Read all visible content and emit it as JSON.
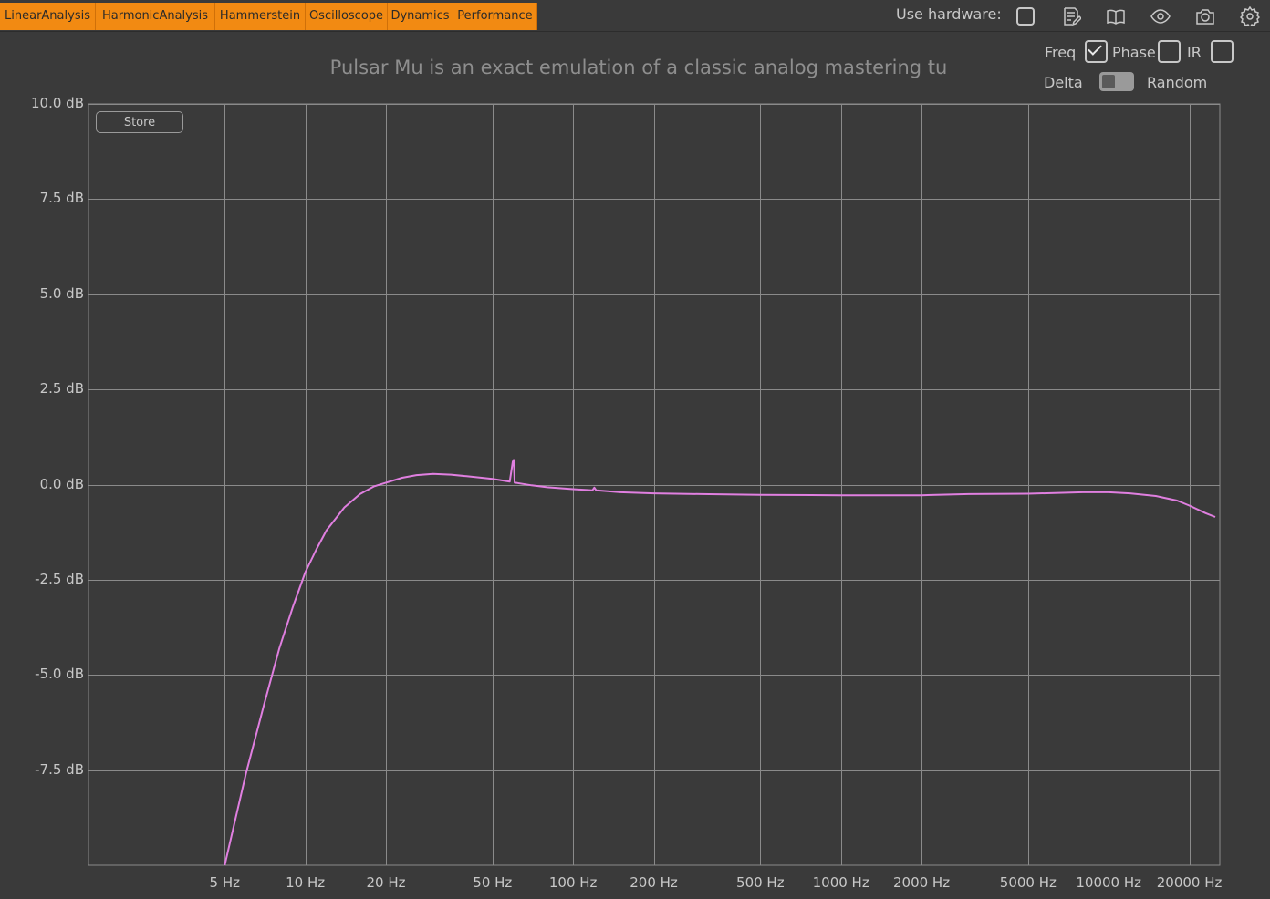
{
  "tabs": [
    "LinearAnalysis",
    "HarmonicAnalysis",
    "Hammerstein",
    "Oscilloscope",
    "Dynamics",
    "Performance"
  ],
  "header": {
    "use_hardware_label": "Use hardware:",
    "icons": [
      "notes-edit-icon",
      "book-icon",
      "eye-icon",
      "camera-icon",
      "gear-icon"
    ]
  },
  "title": "Pulsar Mu is an exact emulation of a classic analog mastering tu",
  "controls": {
    "freq_label": "Freq",
    "freq_checked": true,
    "phase_label": "Phase",
    "phase_checked": false,
    "ir_label": "IR",
    "ir_checked": false,
    "delta_label": "Delta",
    "random_label": "Random",
    "use_hardware_checked": false
  },
  "store_label": "Store",
  "colors": {
    "accent_tab": "#f28a12",
    "background": "#3a3a3a",
    "grid": "#8a8a8a",
    "curve": "#e07fe0"
  },
  "chart_data": {
    "type": "line",
    "title": "",
    "xscale": "log",
    "xlim": [
      1.55,
      26000
    ],
    "ylim": [
      -10,
      10
    ],
    "grid": true,
    "x_ticks": [
      5,
      10,
      20,
      50,
      100,
      200,
      500,
      1000,
      2000,
      5000,
      10000,
      20000
    ],
    "x_tick_labels": [
      "5 Hz",
      "10 Hz",
      "20 Hz",
      "50 Hz",
      "100 Hz",
      "200 Hz",
      "500 Hz",
      "1000 Hz",
      "2000 Hz",
      "5000 Hz",
      "10000 Hz",
      "20000 Hz"
    ],
    "y_ticks": [
      10,
      7.5,
      5,
      2.5,
      0,
      -2.5,
      -5,
      -7.5
    ],
    "y_tick_labels": [
      "10.0 dB",
      "7.5 dB",
      "5.0 dB",
      "2.5 dB",
      "0.0 dB",
      "-2.5 dB",
      "-5.0 dB",
      "-7.5 dB"
    ],
    "series": [
      {
        "x": [
          5,
          6,
          7,
          8,
          9,
          10,
          11,
          12,
          14,
          16,
          18,
          20,
          23,
          26,
          30,
          35,
          40,
          50,
          58,
          59.5,
          60,
          60.5,
          62,
          70,
          80,
          100,
          118,
          120,
          122,
          150,
          200,
          300,
          500,
          1000,
          2000,
          3000,
          5000,
          8000,
          10000,
          12000,
          15000,
          18000,
          20000,
          23000,
          25000
        ],
        "y": [
          -10,
          -7.6,
          -5.8,
          -4.3,
          -3.2,
          -2.3,
          -1.7,
          -1.2,
          -0.6,
          -0.25,
          -0.05,
          0.05,
          0.18,
          0.25,
          0.28,
          0.26,
          0.22,
          0.15,
          0.08,
          0.6,
          0.65,
          0.05,
          0.04,
          -0.02,
          -0.07,
          -0.12,
          -0.15,
          -0.08,
          -0.15,
          -0.2,
          -0.23,
          -0.25,
          -0.27,
          -0.28,
          -0.28,
          -0.25,
          -0.24,
          -0.2,
          -0.2,
          -0.23,
          -0.3,
          -0.42,
          -0.55,
          -0.75,
          -0.85
        ]
      }
    ]
  }
}
